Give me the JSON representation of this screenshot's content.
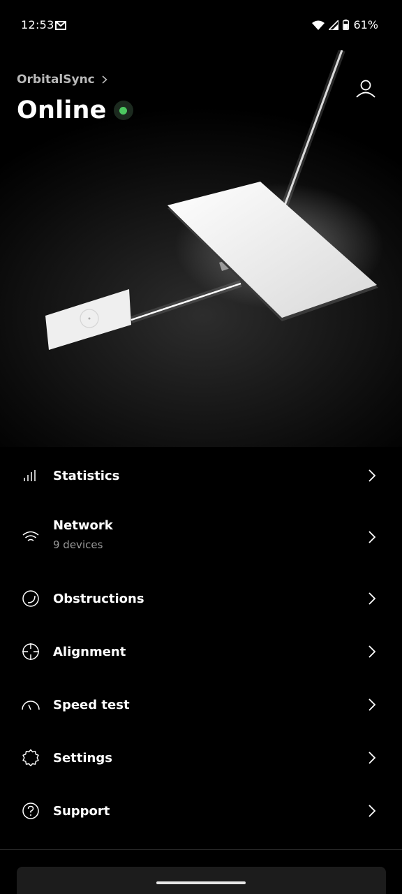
{
  "status_bar": {
    "time": "12:53",
    "battery": "61%",
    "icons": [
      "gmail-icon",
      "wifi-icon",
      "signal-icon",
      "battery-icon"
    ]
  },
  "header": {
    "device_name": "OrbitalSync",
    "status": "Online",
    "status_color": "#4cc860"
  },
  "menu": {
    "items": [
      {
        "label": "Statistics",
        "icon": "statistics-icon"
      },
      {
        "label": "Network",
        "sub": "9 devices",
        "icon": "wifi-icon"
      },
      {
        "label": "Obstructions",
        "icon": "obstructions-icon"
      },
      {
        "label": "Alignment",
        "icon": "crosshair-icon"
      },
      {
        "label": "Speed test",
        "icon": "speedometer-icon"
      },
      {
        "label": "Settings",
        "icon": "gear-icon"
      },
      {
        "label": "Support",
        "icon": "help-icon"
      }
    ]
  }
}
